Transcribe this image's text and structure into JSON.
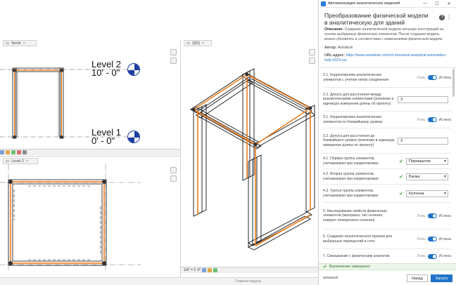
{
  "revit": {
    "tab_top_left": "North",
    "tab_top_right": "{3D}",
    "tab_bottom_left": "Level 2",
    "level2_name": "Level 2",
    "level2_elev": "10' - 0\"",
    "level1_name": "Level 1",
    "level1_elev": "0' - 0\"",
    "scale_3d": "1/8\" = 1'-0\"",
    "status_model": "Главная модель"
  },
  "panel": {
    "window_title": "Автоматизация аналитических моделей",
    "heading": "Преобразование физической модели в аналитическую для зданий",
    "description_label": "Описание:",
    "description": "Создание аналитической модели несущих конструкций на основе выбранных физических элементов. После создания модель можно обновлять в соответствии с изменениями физической модели.",
    "author_label": "Автор:",
    "author": "Autodesk",
    "url_label": "URL-адрес:",
    "url": "https://www.autodesk.com/rvt-structural-analytical-automation-help-2023-rus",
    "rows": [
      {
        "type": "toggle",
        "label": "2.1. Корректировка аналитических элементов с учетом типов соединения",
        "off": "Ложь",
        "on": "Истина"
      },
      {
        "type": "number",
        "label": "2.2. Допуск для расстояния между аналитическими элементами (значение в единицах измерения длины по проекту)",
        "value": "3"
      },
      {
        "type": "toggle",
        "label": "3.1. Корректировка аналитических элементов по ближайшему уровню",
        "off": "Ложь",
        "on": "Истина"
      },
      {
        "type": "number",
        "label": "3.2. Допуск для расстояния до ближайшего уровня (значение в единицах измерения длины по проекту)",
        "value": "3"
      },
      {
        "type": "select",
        "label": "4.1. Первая группа элементов, учитываемая при корректировке",
        "value": "Перекрытие"
      },
      {
        "type": "select",
        "label": "4.2. Вторая группа элементов, учитываемая при корректировке",
        "value": "Балка"
      },
      {
        "type": "select",
        "label": "4.3. Третья группа элементов, учитываемая при корректировке",
        "value": "Колонна"
      },
      {
        "type": "toggle",
        "label": "5. Наследование свойств физических элементов (материал, тип сечения, поворот поперечного сечения)",
        "off": "Ложь",
        "on": "Истина"
      },
      {
        "type": "toggle",
        "label": "6. Создание аналитического проема для выбранных перекрытий и стен",
        "off": "Ложь",
        "on": "Истина"
      },
      {
        "type": "toggle",
        "label": "7. Связывание с физическим аналогом",
        "off": "Ложь",
        "on": "Истина"
      }
    ],
    "done_text": "Выполнение завершено",
    "unsaved": "unsaved",
    "back_label": "Назад",
    "run_label": "Запуск"
  },
  "colors": {
    "accent": "#1f72c8",
    "analytical": "#f07d1a",
    "physical": "#1a1a1a"
  }
}
